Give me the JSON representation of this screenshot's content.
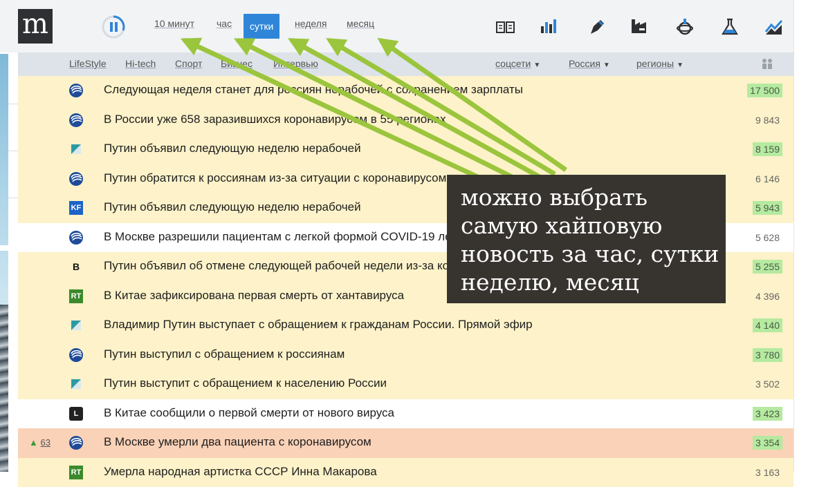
{
  "logo": {
    "letter": "m"
  },
  "periods": [
    {
      "label": "10 минут",
      "active": false
    },
    {
      "label": "час",
      "active": false
    },
    {
      "label": "сутки",
      "active": true
    },
    {
      "label": "неделя",
      "active": false
    },
    {
      "label": "месяц",
      "active": false
    }
  ],
  "category_icons": [
    "newspaper-icon",
    "bar-chart-icon",
    "pen-icon",
    "factory-icon",
    "medal-icon",
    "flask-icon",
    "trend-icon"
  ],
  "subnav": {
    "links": [
      "LifeStyle",
      "Hi-tech",
      "Спорт",
      "Бизнес",
      "Интервью"
    ],
    "dropdowns": [
      "соцсети",
      "Россия",
      "регионы"
    ]
  },
  "colors": {
    "accent": "#2f86d8",
    "highlight_row": "#fdf2c9",
    "pink_row": "#fad2b8",
    "count_badge": "#b5eaa0",
    "arrow": "#9bc53d"
  },
  "news": [
    {
      "source": "ria",
      "title": "Следующая неделя станет для россиян нерабочей с сохранением зарплаты",
      "count": "17 500",
      "badge": true,
      "bg": "hi"
    },
    {
      "source": "ria",
      "title": "В России уже 658 заразившихся коронавирусом в 55 регионах",
      "count": "9 843",
      "badge": false,
      "bg": "hi"
    },
    {
      "source": "lenta",
      "title": "Путин объявил следующую неделю нерабочей",
      "count": "8 159",
      "badge": true,
      "bg": "hi"
    },
    {
      "source": "ria",
      "title": "Путин обратится к россиянам из-за ситуации с коронавирусом",
      "count": "6 146",
      "badge": false,
      "bg": "hi"
    },
    {
      "source": "kp",
      "title": "Путин объявил следующую неделю нерабочей",
      "count": "5 943",
      "badge": true,
      "bg": "hi"
    },
    {
      "source": "ria",
      "title": "В Москве разрешили пациентам с легкой формой COVID-19 лечиться на дому",
      "count": "5 628",
      "badge": false,
      "bg": "wh"
    },
    {
      "source": "vedomosti",
      "title": "Путин объявил об отмене следующей рабочей недели из-за коронавируса",
      "count": "5 255",
      "badge": true,
      "bg": "hi"
    },
    {
      "source": "rt",
      "title": "В Китае зафиксирована первая смерть от хантавируса",
      "count": "4 396",
      "badge": false,
      "bg": "hi"
    },
    {
      "source": "lenta",
      "title": "Владимир Путин выступает с обращением к гражданам России. Прямой эфир",
      "count": "4 140",
      "badge": true,
      "bg": "hi"
    },
    {
      "source": "ria",
      "title": "Путин выступил с обращением к россиянам",
      "count": "3 780",
      "badge": true,
      "bg": "hi"
    },
    {
      "source": "lenta",
      "title": "Путин выступит с обращением к населению России",
      "count": "3 502",
      "badge": false,
      "bg": "hi"
    },
    {
      "source": "life",
      "title": "В Китае сообщили о первой смерти от нового вируса",
      "count": "3 423",
      "badge": true,
      "bg": "wh"
    },
    {
      "source": "ria",
      "title": "В Москве умерли два пациента с коронавирусом",
      "count": "3 354",
      "badge": true,
      "bg": "pk",
      "rise": "63"
    },
    {
      "source": "rt",
      "title": "Умерла народная артистка СССР Инна Макарова",
      "count": "3 163",
      "badge": false,
      "bg": "hi"
    }
  ],
  "source_labels": {
    "kp": "KF",
    "vedomosti": "B",
    "rt": "RT",
    "life": "L"
  },
  "tooltip": {
    "text": "можно выбрать\nсамую хайповую\nновость за час, сутки\nнеделю, месяц"
  }
}
